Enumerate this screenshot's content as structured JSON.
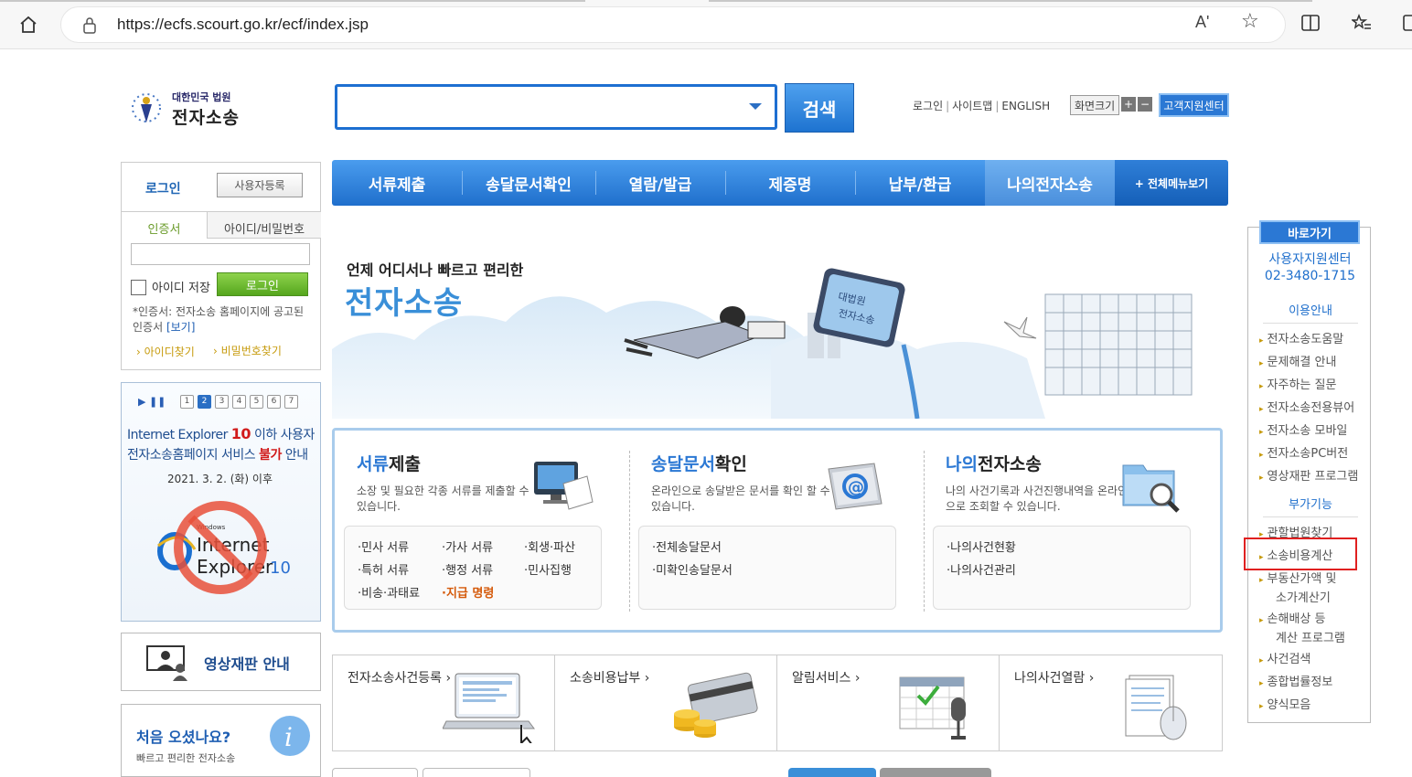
{
  "browser": {
    "url": "https://ecfs.scourt.go.kr/ecf/index.jsp",
    "read_aloud": "Aʹ"
  },
  "header": {
    "logo_line1": "대한민국 법원",
    "logo_line2": "전자소송",
    "search_placeholder": "",
    "search_button": "검색",
    "links": [
      "로그인",
      "사이트맵",
      "ENGLISH"
    ],
    "font_size_label": "화면크기",
    "font_plus": "+",
    "font_minus": "−",
    "support_center": "고객지원센터"
  },
  "login": {
    "title": "로그인",
    "register": "사용자등록",
    "tab_cert": "인증서",
    "tab_id": "아이디/비밀번호",
    "save_id": "아이디 저장",
    "login_button": "로그인",
    "note": "*인증서: 전자소송 홈페이지에 공고된 인증서",
    "note_link": "[보기]",
    "find_id": "아이디찾기",
    "find_pw": "비밀번호찾기"
  },
  "ie_notice": {
    "pages": [
      "1",
      "2",
      "3",
      "4",
      "5",
      "6",
      "7"
    ],
    "line1_pre": "Internet Explorer ",
    "line1_num": "10",
    "line1_post": " 이하 사용자",
    "line2_pre": "전자소송홈페이지 서비스 ",
    "line2_red": "불가",
    "line2_post": " 안내",
    "date": "2021. 3. 2. (화) 이후",
    "logo_small": "Windows",
    "logo_line1": "Internet",
    "logo_line2": "Explorer",
    "logo_ver": "10"
  },
  "video_box": {
    "label": "영상재판 안내"
  },
  "first_box": {
    "question": "처음 오셨나요?",
    "sub": "빠르고 편리한 전자소송"
  },
  "nav": {
    "items": [
      "서류제출",
      "송달문서확인",
      "열람/발급",
      "제증명",
      "납부/환급",
      "나의전자소송"
    ],
    "all_menu": "+ 전체메뉴보기"
  },
  "banner": {
    "sub": "언제 어디서나 빠르고 편리한",
    "main": "전자소송",
    "monitor_text1": "대법원",
    "monitor_text2": "전자소송"
  },
  "services": [
    {
      "title_blue": "서류",
      "title_rest": "제출",
      "desc": "소장 및 필요한 각종 서류를 제출할 수 있습니다.",
      "items": [
        "·민사 서류",
        "·가사 서류",
        "·회생·파산",
        "·특허 서류",
        "·행정 서류",
        "·민사집행",
        "·비송·과태료",
        "·지급 명령"
      ]
    },
    {
      "title_blue": "송달문서",
      "title_rest": "확인",
      "desc": "온라인으로 송달받은 문서를 확인 할 수 있습니다.",
      "items": [
        "·전체송달문서",
        "·미확인송달문서"
      ]
    },
    {
      "title_blue": "나의",
      "title_rest": "전자소송",
      "desc": "나의 사건기록과 사건진행내역을 온라인으로 조회할 수 있습니다.",
      "items": [
        "·나의사건현황",
        "·나의사건관리"
      ]
    }
  ],
  "quick": [
    "전자소송사건등록 ›",
    "소송비용납부 ›",
    "알림서비스 ›",
    "나의사건열람 ›"
  ],
  "quickmenu": {
    "header": "바로가기",
    "support1": "사용자지원센터",
    "support2": "02-3480-1715",
    "section1": "이용안내",
    "items1": [
      "전자소송도움말",
      "문제해결 안내",
      "자주하는 질문",
      "전자소송전용뷰어",
      "전자소송 모바일",
      "전자소송PC버전",
      "영상재판 프로그램"
    ],
    "section2": "부가기능",
    "items2": [
      "관할법원찾기",
      "소송비용계산",
      "부동산가액 및",
      "소가계산기",
      "손해배상 등",
      "계산 프로그램",
      "사건검색",
      "종합법률정보",
      "양식모음"
    ]
  },
  "colors": {
    "brand_blue": "#1f6fcc",
    "highlight_red": "#e02020",
    "login_green": "#55a61d"
  }
}
